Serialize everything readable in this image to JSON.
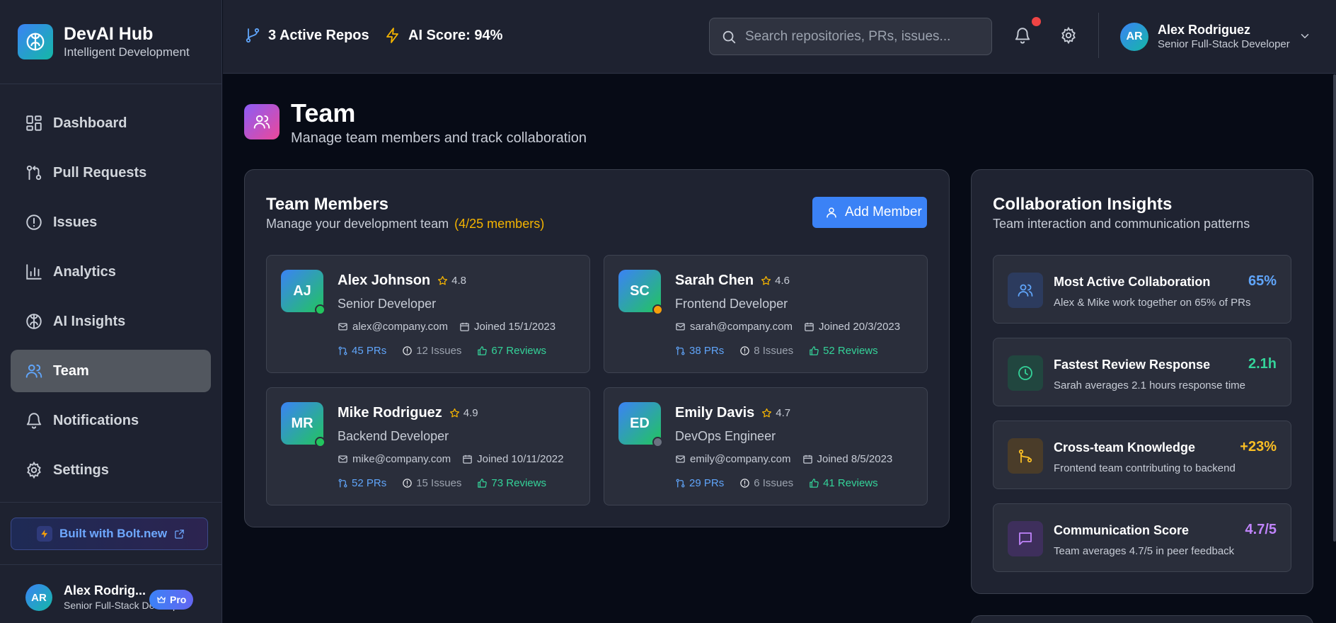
{
  "brand": {
    "title": "DevAI Hub",
    "subtitle": "Intelligent Development"
  },
  "sidebar": {
    "items": [
      {
        "label": "Dashboard",
        "icon": "layout-grid-icon"
      },
      {
        "label": "Pull Requests",
        "icon": "git-pull-request-icon"
      },
      {
        "label": "Issues",
        "icon": "alert-circle-icon"
      },
      {
        "label": "Analytics",
        "icon": "bar-chart-icon"
      },
      {
        "label": "AI Insights",
        "icon": "brain-icon"
      },
      {
        "label": "Team",
        "icon": "users-icon",
        "active": true
      },
      {
        "label": "Notifications",
        "icon": "bell-icon"
      },
      {
        "label": "Settings",
        "icon": "gear-icon"
      }
    ],
    "bolt_label": "Built with Bolt.new",
    "user": {
      "initials": "AR",
      "name": "Alex Rodrig...",
      "role": "Senior Full-Stack Developer",
      "badge": "Pro"
    }
  },
  "topbar": {
    "repos": "3 Active Repos",
    "ai_score": "AI Score: 94%",
    "search_placeholder": "Search repositories, PRs, issues...",
    "user": {
      "initials": "AR",
      "name": "Alex Rodriguez",
      "role": "Senior Full-Stack Developer"
    }
  },
  "page": {
    "title": "Team",
    "subtitle": "Manage team members and track collaboration"
  },
  "team_panel": {
    "title": "Team Members",
    "subtitle": "Manage your development team",
    "count": "(4/25 members)",
    "add_label": "Add Member",
    "members": [
      {
        "initials": "AJ",
        "name": "Alex Johnson",
        "rating": "4.8",
        "role": "Senior Developer",
        "email": "alex@company.com",
        "joined": "Joined 15/1/2023",
        "prs": "45 PRs",
        "issues": "12 Issues",
        "reviews": "67 Reviews",
        "status_color": "#22c55e"
      },
      {
        "initials": "SC",
        "name": "Sarah Chen",
        "rating": "4.6",
        "role": "Frontend Developer",
        "email": "sarah@company.com",
        "joined": "Joined 20/3/2023",
        "prs": "38 PRs",
        "issues": "8 Issues",
        "reviews": "52 Reviews",
        "status_color": "#f59e0b"
      },
      {
        "initials": "MR",
        "name": "Mike Rodriguez",
        "rating": "4.9",
        "role": "Backend Developer",
        "email": "mike@company.com",
        "joined": "Joined 10/11/2022",
        "prs": "52 PRs",
        "issues": "15 Issues",
        "reviews": "73 Reviews",
        "status_color": "#22c55e"
      },
      {
        "initials": "ED",
        "name": "Emily Davis",
        "rating": "4.7",
        "role": "DevOps Engineer",
        "email": "emily@company.com",
        "joined": "Joined 8/5/2023",
        "prs": "29 PRs",
        "issues": "6 Issues",
        "reviews": "41 Reviews",
        "status_color": "#6b7280"
      }
    ]
  },
  "insights_panel": {
    "title": "Collaboration Insights",
    "subtitle": "Team interaction and communication patterns",
    "items": [
      {
        "title": "Most Active Collaboration",
        "desc": "Alex & Mike work together on 65% of PRs",
        "value": "65%",
        "color": "#60a5fa",
        "icon": "users-icon"
      },
      {
        "title": "Fastest Review Response",
        "desc": "Sarah averages 2.1 hours response time",
        "value": "2.1h",
        "color": "#34d399",
        "icon": "clock-icon"
      },
      {
        "title": "Cross-team Knowledge",
        "desc": "Frontend team contributing to backend",
        "value": "+23%",
        "color": "#fbbf24",
        "icon": "git-branch-icon"
      },
      {
        "title": "Communication Score",
        "desc": "Team averages 4.7/5 in peer feedback",
        "value": "4.7/5",
        "color": "#c084fc",
        "icon": "message-square-icon"
      }
    ]
  }
}
